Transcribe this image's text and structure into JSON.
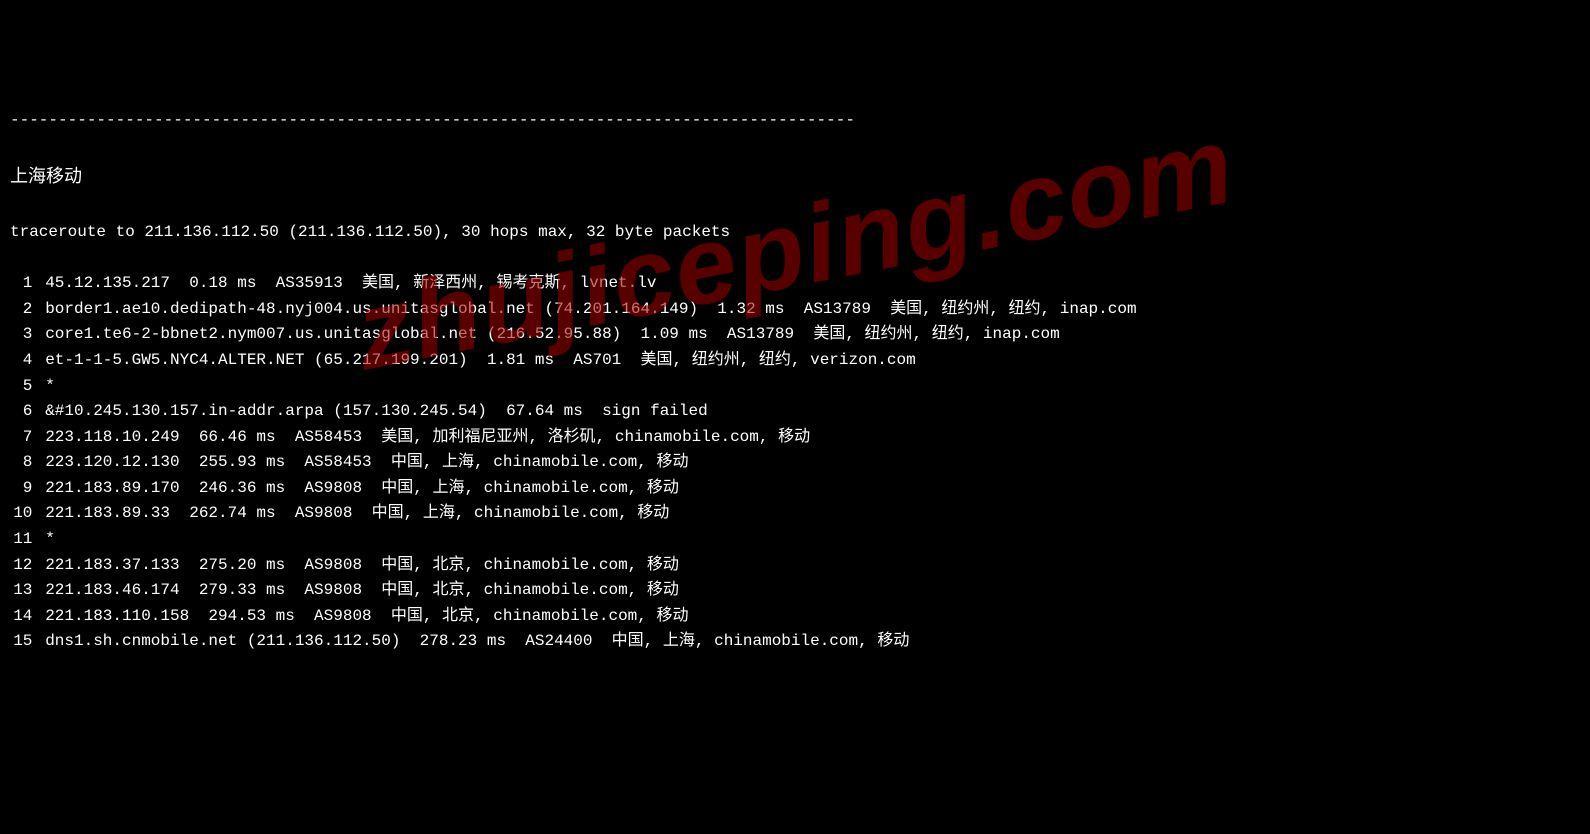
{
  "divider": "----------------------------------------------------------------------------------------",
  "title": "上海移动",
  "trace_header": "traceroute to 211.136.112.50 (211.136.112.50), 30 hops max, 32 byte packets",
  "hops": [
    {
      "num": "1",
      "line": "45.12.135.217  0.18 ms  AS35913  美国, 新泽西州, 锡考克斯, lvnet.lv"
    },
    {
      "num": "2",
      "line": "border1.ae10.dedipath-48.nyj004.us.unitasglobal.net (74.201.164.149)  1.32 ms  AS13789  美国, 纽约州, 纽约, inap.com"
    },
    {
      "num": "3",
      "line": "core1.te6-2-bbnet2.nym007.us.unitasglobal.net (216.52.95.88)  1.09 ms  AS13789  美国, 纽约州, 纽约, inap.com"
    },
    {
      "num": "4",
      "line": "et-1-1-5.GW5.NYC4.ALTER.NET (65.217.199.201)  1.81 ms  AS701  美国, 纽约州, 纽约, verizon.com"
    },
    {
      "num": "5",
      "line": "*"
    },
    {
      "num": "6",
      "line": "&#10.245.130.157.in-addr.arpa (157.130.245.54)  67.64 ms  sign failed"
    },
    {
      "num": "7",
      "line": "223.118.10.249  66.46 ms  AS58453  美国, 加利福尼亚州, 洛杉矶, chinamobile.com, 移动"
    },
    {
      "num": "8",
      "line": "223.120.12.130  255.93 ms  AS58453  中国, 上海, chinamobile.com, 移动"
    },
    {
      "num": "9",
      "line": "221.183.89.170  246.36 ms  AS9808  中国, 上海, chinamobile.com, 移动"
    },
    {
      "num": "10",
      "line": "221.183.89.33  262.74 ms  AS9808  中国, 上海, chinamobile.com, 移动"
    },
    {
      "num": "11",
      "line": "*"
    },
    {
      "num": "12",
      "line": "221.183.37.133  275.20 ms  AS9808  中国, 北京, chinamobile.com, 移动"
    },
    {
      "num": "13",
      "line": "221.183.46.174  279.33 ms  AS9808  中国, 北京, chinamobile.com, 移动"
    },
    {
      "num": "14",
      "line": "221.183.110.158  294.53 ms  AS9808  中国, 北京, chinamobile.com, 移动"
    },
    {
      "num": "15",
      "line": "dns1.sh.cnmobile.net (211.136.112.50)  278.23 ms  AS24400  中国, 上海, chinamobile.com, 移动"
    }
  ],
  "watermark": "zhujiceping.com"
}
